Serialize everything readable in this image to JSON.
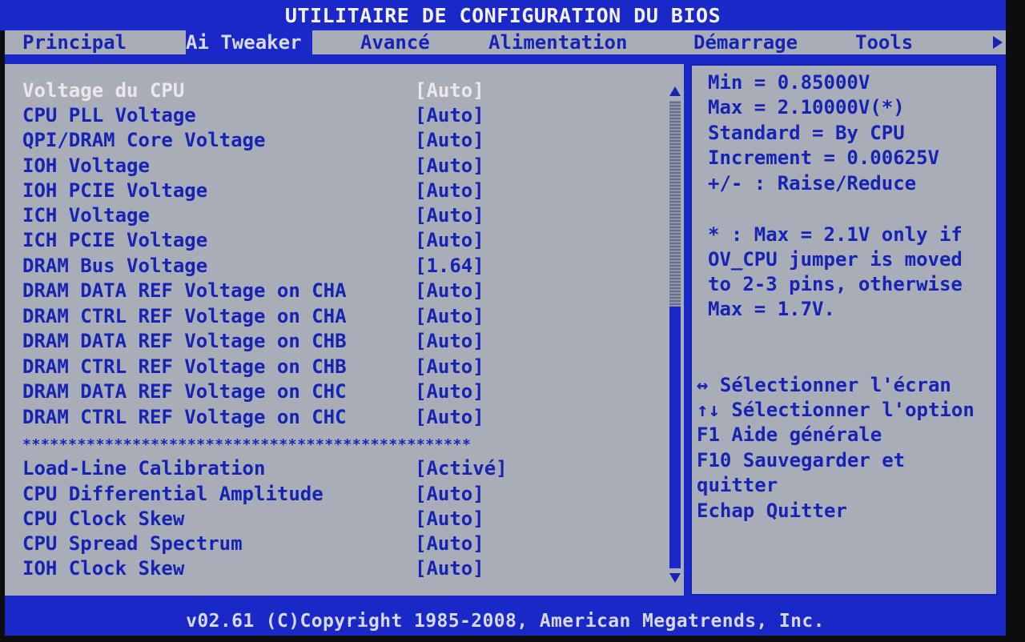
{
  "title": "UTILITAIRE DE CONFIGURATION DU BIOS",
  "menu": [
    {
      "label": "Principal",
      "active": false
    },
    {
      "label": "Ai Tweaker",
      "active": true
    },
    {
      "label": "Avancé",
      "active": false
    },
    {
      "label": "Alimentation",
      "active": false
    },
    {
      "label": "Démarrage",
      "active": false
    },
    {
      "label": "Tools",
      "active": false
    }
  ],
  "settings_top": [
    {
      "label": "Voltage du CPU",
      "value": "[Auto]",
      "selected": true
    },
    {
      "label": "CPU PLL Voltage",
      "value": "[Auto]"
    },
    {
      "label": "QPI/DRAM Core Voltage",
      "value": "[Auto]"
    },
    {
      "label": "IOH Voltage",
      "value": "[Auto]"
    },
    {
      "label": "IOH PCIE Voltage",
      "value": "[Auto]"
    },
    {
      "label": "ICH Voltage",
      "value": "[Auto]"
    },
    {
      "label": "ICH PCIE Voltage",
      "value": "[Auto]"
    },
    {
      "label": "DRAM Bus Voltage",
      "value": "[1.64]"
    },
    {
      "label": "DRAM DATA REF Voltage on CHA",
      "value": "[Auto]"
    },
    {
      "label": "DRAM CTRL REF Voltage on CHA",
      "value": "[Auto]"
    },
    {
      "label": "DRAM DATA REF Voltage on CHB",
      "value": "[Auto]"
    },
    {
      "label": "DRAM CTRL REF Voltage on CHB",
      "value": "[Auto]"
    },
    {
      "label": "DRAM DATA REF Voltage on CHC",
      "value": "[Auto]"
    },
    {
      "label": "DRAM CTRL REF Voltage on CHC",
      "value": "[Auto]"
    }
  ],
  "separator": "*************************************************",
  "settings_bottom": [
    {
      "label": "Load-Line Calibration",
      "value": "[Activé]"
    },
    {
      "label": "CPU Differential Amplitude",
      "value": "[Auto]"
    },
    {
      "label": "CPU Clock Skew",
      "value": "[Auto]"
    },
    {
      "label": "CPU Spread Spectrum",
      "value": "[Auto]"
    },
    {
      "label": "IOH Clock Skew",
      "value": "[Auto]"
    }
  ],
  "scrollbar": {
    "position_fraction": 0.0,
    "visible_fraction": 0.44
  },
  "help": {
    "info": [
      "Min = 0.85000V",
      "Max = 2.10000V(*)",
      "Standard  = By CPU",
      "Increment = 0.00625V",
      "+/- : Raise/Reduce"
    ],
    "note": [
      "* : Max = 2.1V only if",
      "OV_CPU jumper is moved",
      "to 2-3 pins, otherwise",
      "Max = 1.7V."
    ],
    "keys": [
      "↔ Sélectionner l'écran",
      "↑↓ Sélectionner l'option",
      "F1   Aide générale",
      "F10  Sauvegarder et",
      "     quitter",
      "Echap  Quitter"
    ]
  },
  "footer": "v02.61 (C)Copyright 1985-2008, American Megatrends, Inc.",
  "colors": {
    "blue": "#1a28c8",
    "text_blue": "#1623b4",
    "panel_gray": "#a9adb8",
    "highlight_text": "#ece8ea"
  }
}
